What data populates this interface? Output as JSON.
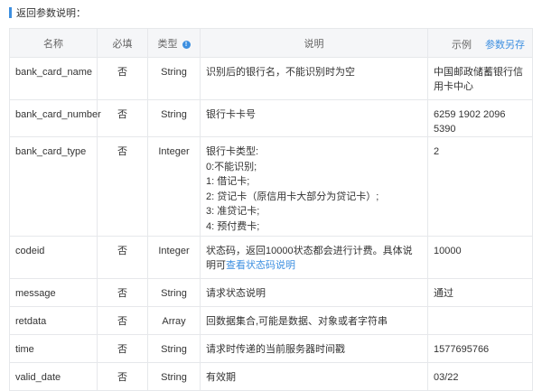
{
  "section_title": "返回参数说明：",
  "columns": {
    "name": "名称",
    "required": "必填",
    "type": "类型",
    "type_info_icon": "info-icon",
    "description": "说明",
    "example": "示例",
    "save_example": "参数另存"
  },
  "rows": [
    {
      "name": "bank_card_name",
      "required": "否",
      "type": "String",
      "description": "识别后的银行名，不能识别时为空",
      "example": "中国邮政储蓄银行信用卡中心"
    },
    {
      "name": "bank_card_number",
      "required": "否",
      "type": "String",
      "description": "银行卡卡号",
      "example": "6259 1902 2096 5390"
    },
    {
      "name": "bank_card_type",
      "required": "否",
      "type": "Integer",
      "description_lines": [
        "银行卡类型:",
        "0:不能识别;",
        "1: 借记卡;",
        "2: 贷记卡（原信用卡大部分为贷记卡）;",
        "3: 准贷记卡;",
        "4: 预付费卡;"
      ],
      "example": "2"
    },
    {
      "name": "codeid",
      "required": "否",
      "type": "Integer",
      "description": "状态码，返回10000状态都会进行计费。具体说明可",
      "description_link": "查看状态码说明",
      "example": "10000"
    },
    {
      "name": "message",
      "required": "否",
      "type": "String",
      "description": "请求状态说明",
      "example": "通过"
    },
    {
      "name": "retdata",
      "required": "否",
      "type": "Array",
      "description": "回数据集合,可能是数据、对象或者字符串",
      "example": ""
    },
    {
      "name": "time",
      "required": "否",
      "type": "String",
      "description": "请求时传递的当前服务器时间戳",
      "example": "1577695766"
    },
    {
      "name": "valid_date",
      "required": "否",
      "type": "String",
      "description": "有效期",
      "example": "03/22"
    }
  ]
}
